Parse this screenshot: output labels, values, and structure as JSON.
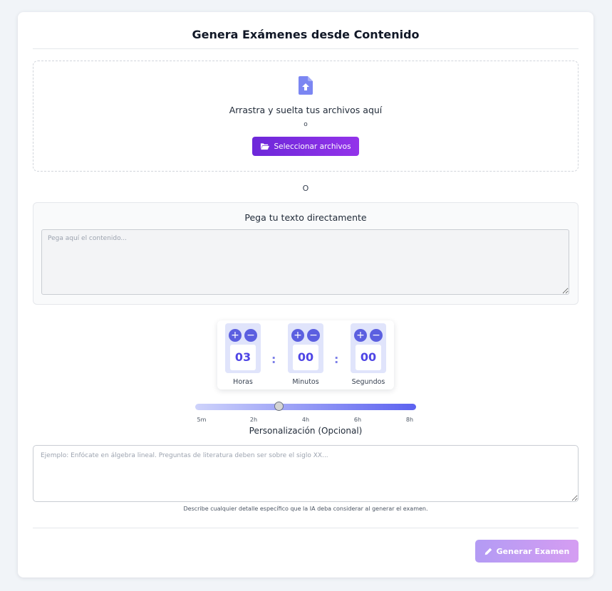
{
  "page": {
    "title": "Genera Exámenes desde Contenido"
  },
  "upload": {
    "icon": "file-upload-icon",
    "drop_text": "Arrastra y suelta tus archivos aquí",
    "or_text": "o",
    "button_label": "Seleccionar archivos",
    "button_icon": "folder-open-icon"
  },
  "separator": {
    "text": "O"
  },
  "paste": {
    "title": "Pega tu texto directamente",
    "placeholder": "Pega aquí el contenido...",
    "value": ""
  },
  "timer": {
    "hours": {
      "value": "03",
      "label": "Horas"
    },
    "minutes": {
      "value": "00",
      "label": "Minutos"
    },
    "seconds": {
      "value": "00",
      "label": "Segundos"
    },
    "plus_symbol": "+",
    "minus_symbol": "−",
    "separator": ":"
  },
  "duration_slider": {
    "ticks": [
      "5m",
      "2h",
      "4h",
      "6h",
      "8h"
    ],
    "min_minutes": 5,
    "max_minutes": 480,
    "value_minutes": 180
  },
  "customization": {
    "title": "Personalización (Opcional)",
    "placeholder": "Ejemplo: Enfócate en álgebra lineal. Preguntas de literatura deben ser sobre el siglo XX...",
    "value": "",
    "hint": "Describe cualquier detalle específico que la IA deba considerar al generar el examen."
  },
  "actions": {
    "generate_label": "Generar Examen",
    "generate_icon": "pencil-icon"
  },
  "colors": {
    "primary_gradient_start": "#6d28d9",
    "primary_gradient_end": "#9333ea",
    "accent": "#5b5fe0",
    "disabled_gradient_start": "#b39bf4",
    "disabled_gradient_end": "#d59df2"
  }
}
